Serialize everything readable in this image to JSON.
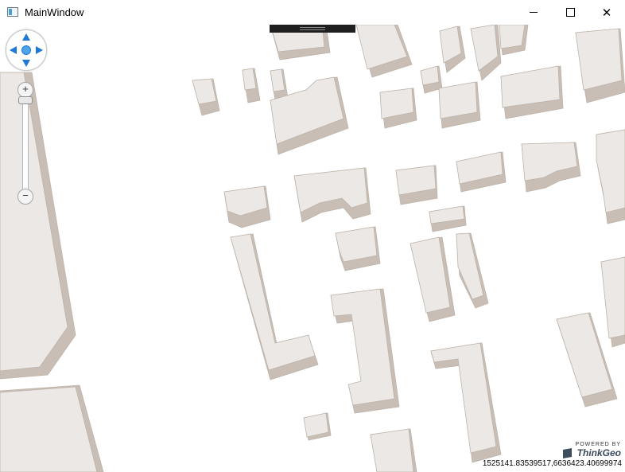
{
  "window": {
    "title": "MainWindow",
    "minimize_icon": "minimize-icon",
    "maximize_icon": "maximize-icon",
    "close_icon": "close-icon",
    "close_glyph": "✕"
  },
  "map": {
    "colors": {
      "background": "#ffffff",
      "building_roof": "#ece8e5",
      "building_side": "#c8beb5",
      "building_outline": "#bdb3a9",
      "road_edge": "#a9a095"
    },
    "zoom": {
      "in_label": "+",
      "out_label": "−"
    },
    "pan_icons": [
      "pan-up-icon",
      "pan-down-icon",
      "pan-left-icon",
      "pan-right-icon",
      "pan-center-icon"
    ],
    "logo": {
      "top_text": "POWERED BY",
      "name": "ThinkGeo"
    },
    "coordinates": "1525141.83539517,6636423.40699974"
  }
}
